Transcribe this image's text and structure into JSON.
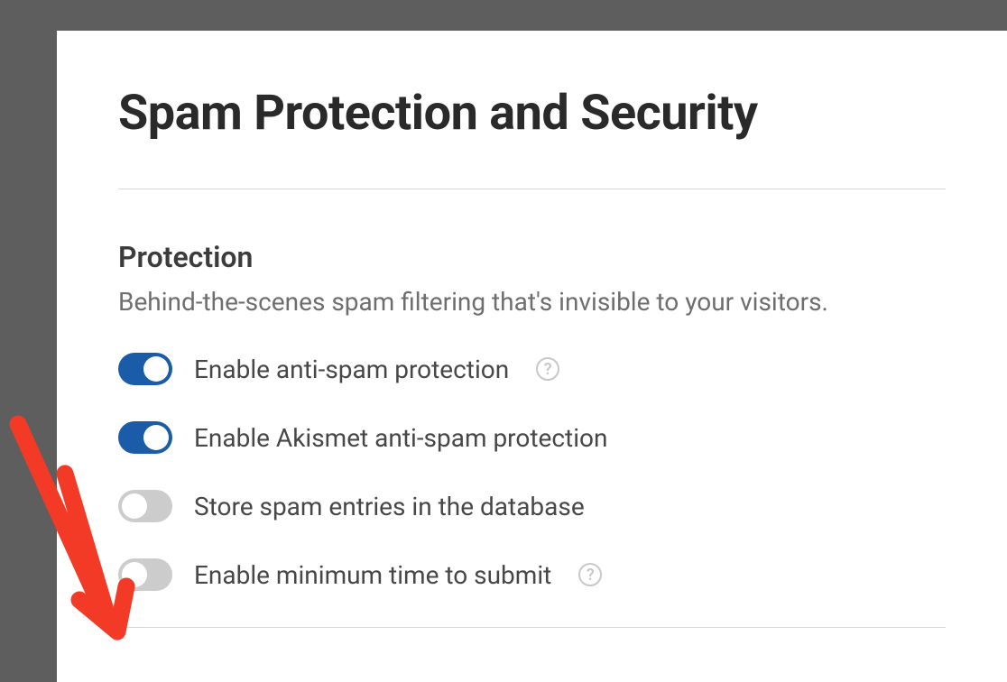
{
  "page": {
    "title": "Spam Protection and Security"
  },
  "section": {
    "title": "Protection",
    "description": "Behind-the-scenes spam filtering that's invisible to your visitors."
  },
  "toggles": [
    {
      "label": "Enable anti-spam protection",
      "enabled": true,
      "hasHelp": true
    },
    {
      "label": "Enable Akismet anti-spam protection",
      "enabled": true,
      "hasHelp": false
    },
    {
      "label": "Store spam entries in the database",
      "enabled": false,
      "hasHelp": false
    },
    {
      "label": "Enable minimum time to submit",
      "enabled": false,
      "hasHelp": true
    }
  ]
}
